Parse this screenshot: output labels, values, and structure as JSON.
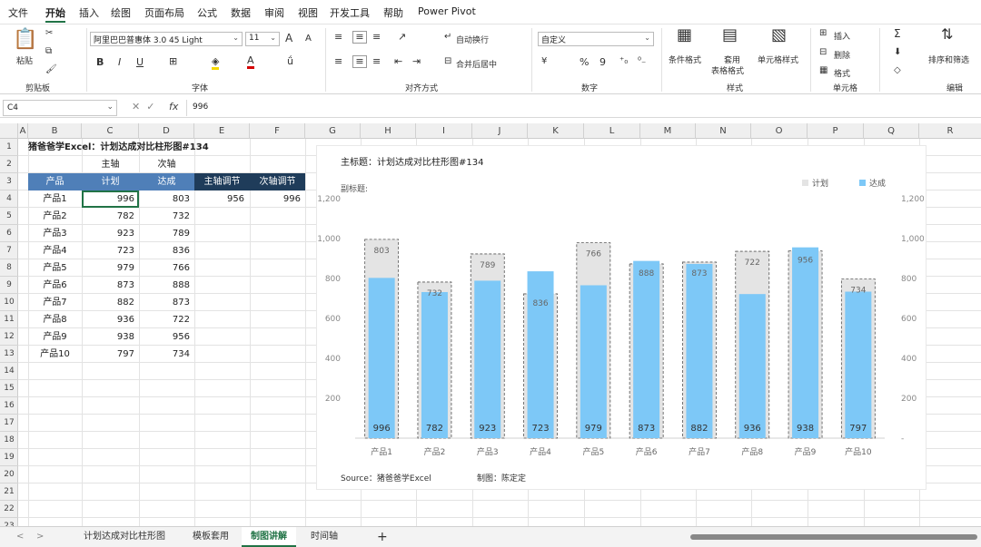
{
  "menu": {
    "items": [
      "文件",
      "开始",
      "插入",
      "绘图",
      "页面布局",
      "公式",
      "数据",
      "审阅",
      "视图",
      "开发工具",
      "帮助",
      "Power Pivot"
    ]
  },
  "ribbon": {
    "clipboard": {
      "paste_label": "粘贴",
      "group_label": "剪贴板"
    },
    "font": {
      "font_name": "阿里巴巴普惠体 3.0 45 Light",
      "font_size": "11",
      "bold": "B",
      "italic": "I",
      "underline": "U",
      "grow": "A",
      "shrink": "A",
      "group_label": "字体"
    },
    "alignment": {
      "wrap_label": "自动换行",
      "merge_label": "合并后居中",
      "group_label": "对齐方式"
    },
    "number": {
      "format": "自定义",
      "percent": "%",
      "comma": "9",
      "group_label": "数字"
    },
    "styles": {
      "cond_label": "条件格式",
      "table_label_1": "套用",
      "table_label_2": "表格格式",
      "cell_label": "单元格样式",
      "group_label": "样式"
    },
    "cells": {
      "insert_label": "插入",
      "delete_label": "删除",
      "format_label": "格式",
      "group_label": "单元格"
    },
    "editing": {
      "sort_label": "排序和筛选",
      "group_label": "编辑"
    }
  },
  "formula_bar": {
    "name_box": "C4",
    "value": "996",
    "cancel": "✕",
    "enter": "✓",
    "fx": "fx"
  },
  "columns": [
    "A",
    "B",
    "C",
    "D",
    "E",
    "F",
    "G",
    "H",
    "I",
    "J",
    "K",
    "L",
    "M",
    "N",
    "O",
    "P",
    "Q",
    "R"
  ],
  "rows": [
    "1",
    "2",
    "3",
    "4",
    "5",
    "6",
    "7",
    "8",
    "9",
    "10",
    "11",
    "12",
    "13",
    "14",
    "15",
    "16",
    "17",
    "18",
    "19",
    "20",
    "21",
    "22",
    "23"
  ],
  "sheet": {
    "title": "猪爸爸学Excel：计划达成对比柱形图#134",
    "axis_labels": {
      "main": "主轴",
      "secondary": "次轴"
    },
    "headers": {
      "product": "产品",
      "plan": "计划",
      "actual": "达成",
      "main_adjust": "主轴调节",
      "sec_adjust": "次轴调节"
    },
    "adjust_values": {
      "main": "956",
      "secondary": "996"
    },
    "rows": [
      {
        "product": "产品1",
        "plan": "996",
        "actual": "803"
      },
      {
        "product": "产品2",
        "plan": "782",
        "actual": "732"
      },
      {
        "product": "产品3",
        "plan": "923",
        "actual": "789"
      },
      {
        "product": "产品4",
        "plan": "723",
        "actual": "836"
      },
      {
        "product": "产品5",
        "plan": "979",
        "actual": "766"
      },
      {
        "product": "产品6",
        "plan": "873",
        "actual": "888"
      },
      {
        "product": "产品7",
        "plan": "882",
        "actual": "873"
      },
      {
        "product": "产品8",
        "plan": "936",
        "actual": "722"
      },
      {
        "product": "产品9",
        "plan": "938",
        "actual": "956"
      },
      {
        "product": "产品10",
        "plan": "797",
        "actual": "734"
      }
    ]
  },
  "chart_data": {
    "type": "bar",
    "title": "主标题：计划达成对比柱形图#134",
    "subtitle": "副标题:",
    "categories": [
      "产品1",
      "产品2",
      "产品3",
      "产品4",
      "产品5",
      "产品6",
      "产品7",
      "产品8",
      "产品9",
      "产品10"
    ],
    "series": [
      {
        "name": "计划",
        "values": [
          996,
          782,
          923,
          723,
          979,
          873,
          882,
          936,
          938,
          797
        ],
        "color": "#e4e4e4"
      },
      {
        "name": "达成",
        "values": [
          803,
          732,
          789,
          836,
          766,
          888,
          873,
          722,
          956,
          734
        ],
        "color": "#7dc8f7"
      }
    ],
    "ylim": [
      0,
      1200
    ],
    "yticks": [
      "",
      "200",
      "400",
      "600",
      "800",
      "1,000",
      "1,200"
    ],
    "y2ticks": [
      "-",
      "200",
      "400",
      "600",
      "800",
      "1,000",
      "1,200"
    ],
    "legend_position": "top-right",
    "source": "Source：猪爸爸学Excel",
    "author": "制图：陈定定"
  },
  "tabs": {
    "items": [
      "计划达成对比柱形图",
      "模板套用",
      "制图讲解",
      "时间轴"
    ],
    "active": 2,
    "add": "+",
    "prev": "<",
    "next": ">"
  }
}
